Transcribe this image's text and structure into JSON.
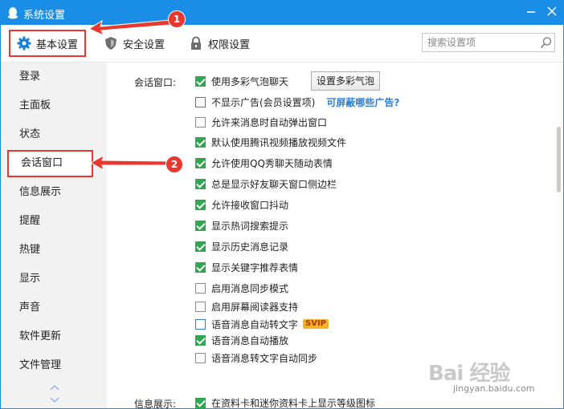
{
  "window": {
    "title": "系统设置"
  },
  "colors": {
    "accent": "#1a8ee6",
    "annotation": "#e8382f",
    "check_green": "#2fa84f",
    "link_blue": "#2d7fd6"
  },
  "toolbar": {
    "tabs": [
      {
        "label": "基本设置",
        "icon": "gear-icon"
      },
      {
        "label": "安全设置",
        "icon": "shield-icon"
      },
      {
        "label": "权限设置",
        "icon": "lock-icon"
      }
    ],
    "search_placeholder": "搜索设置项"
  },
  "sidebar": {
    "items": [
      "登录",
      "主面板",
      "状态",
      "会话窗口",
      "信息展示",
      "提醒",
      "热键",
      "显示",
      "声音",
      "软件更新",
      "文件管理"
    ],
    "active_index": 3
  },
  "content": {
    "session_label": "会话窗口:",
    "bubble_button": "设置多彩气泡",
    "options": [
      {
        "label": "使用多彩气泡聊天",
        "checked": true
      },
      {
        "label": "不显示广告(会员设置项)",
        "checked": false,
        "link": "可屏蔽哪些广告?"
      },
      {
        "label": "允许来消息时自动弹出窗口",
        "checked": false
      },
      {
        "label": "默认使用腾讯视频播放视频文件",
        "checked": true
      },
      {
        "label": "允许使用QQ秀聊天随动表情",
        "checked": true
      },
      {
        "label": "总是显示好友聊天窗口侧边栏",
        "checked": true
      },
      {
        "label": "允许接收窗口抖动",
        "checked": true
      },
      {
        "label": "显示热词搜索提示",
        "checked": true
      },
      {
        "label": "显示历史消息记录",
        "checked": true
      },
      {
        "label": "显示关键字推荐表情",
        "checked": true
      },
      {
        "label": "启用消息同步模式",
        "checked": false
      },
      {
        "label": "启用屏幕阅读器支持",
        "checked": false
      },
      {
        "label": "语音消息自动转文字",
        "checked": false,
        "badge": "SVIP"
      },
      {
        "label": "语音消息自动播放",
        "checked": true
      },
      {
        "label": "语音消息转文字自动同步",
        "checked": false
      }
    ],
    "info_label": "信息展示:",
    "info_option": {
      "label": "在资料卡和迷你资料卡上显示等级图标",
      "checked": true
    }
  },
  "annotations": [
    "1",
    "2"
  ],
  "watermark": {
    "brand": "Bai 经验",
    "url": "jingyan.baidu.com"
  }
}
